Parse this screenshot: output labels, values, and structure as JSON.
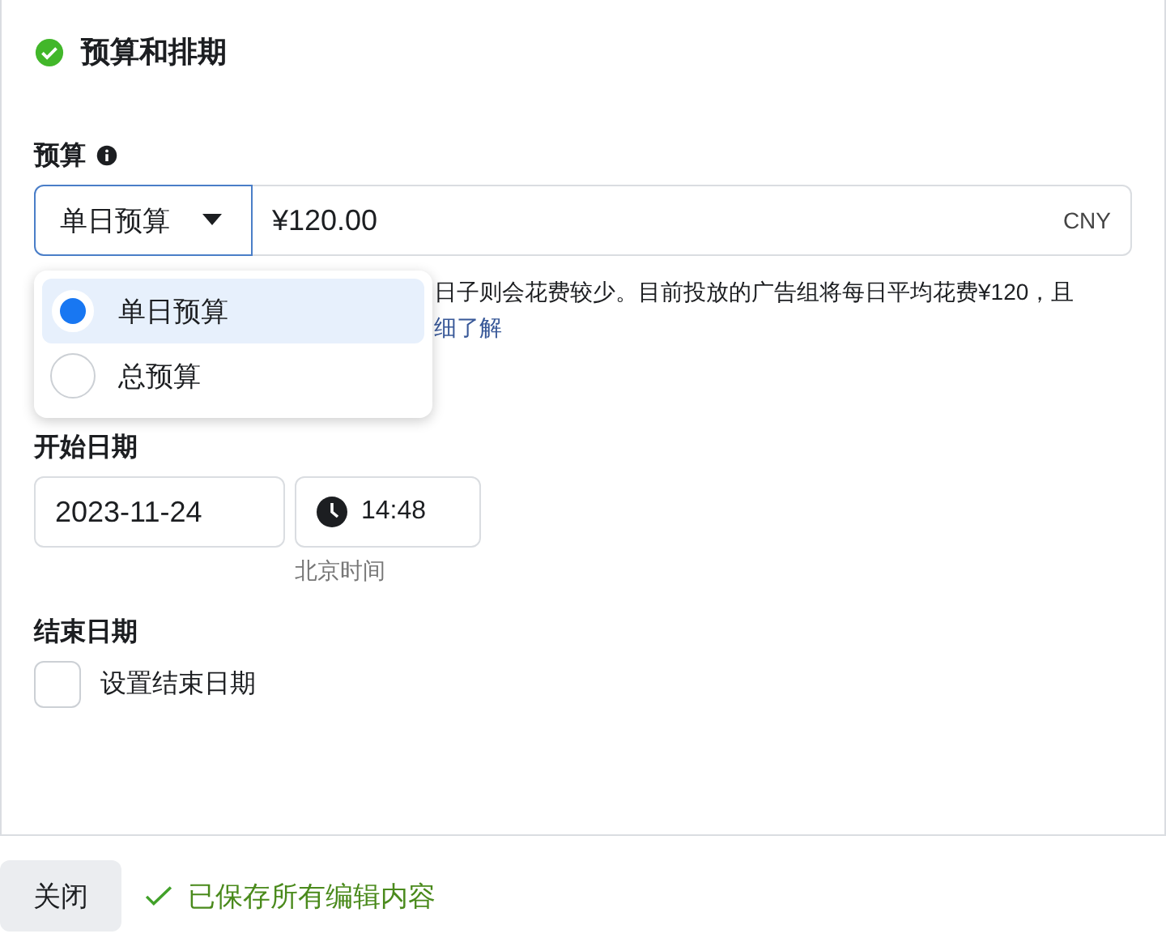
{
  "section": {
    "title": "预算和排期"
  },
  "budget": {
    "label": "预算",
    "type_select": "单日预算",
    "amount": "¥120.00",
    "currency": "CNY",
    "description": "日子则会花费较少。目前投放的广告组将每日平均花费¥120，且",
    "link": "细了解",
    "options": [
      {
        "label": "单日预算",
        "selected": true
      },
      {
        "label": "总预算",
        "selected": false
      }
    ]
  },
  "start": {
    "label": "开始日期",
    "date": "2023-11-24",
    "time": "14:48",
    "timezone": "北京时间"
  },
  "end": {
    "label": "结束日期",
    "checkbox": {
      "label": "设置结束日期",
      "checked": false
    }
  },
  "footer": {
    "close": "关闭",
    "status": "已保存所有编辑内容"
  }
}
